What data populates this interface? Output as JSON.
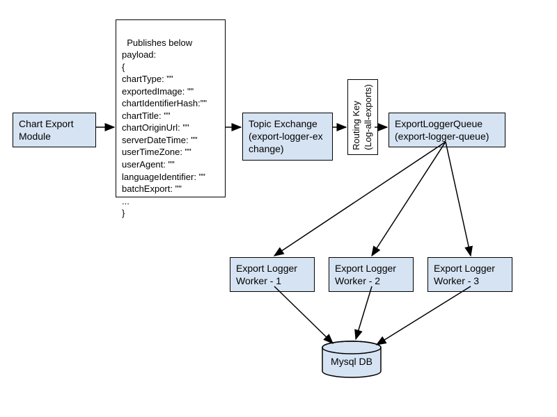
{
  "nodes": {
    "chart_export_module": "Chart Export\nModule",
    "topic_exchange_l1": "Topic Exchange",
    "topic_exchange_l2": "(export-logger-ex\nchange)",
    "routing_key_l1": "Routing Key",
    "routing_key_l2": "(Log-all-exports)",
    "export_logger_queue_l1": "ExportLoggerQueue",
    "export_logger_queue_l2": "(export-logger-queue)",
    "worker1": "Export Logger\nWorker - 1",
    "worker2": "Export Logger\nWorker - 2",
    "worker3": "Export Logger\nWorker - 3",
    "db": "Mysql DB"
  },
  "payload": "Publishes below\npayload:\n{\nchartType: \"\"\nexportedImage: \"\"\nchartIdentifierHash:\"\"\nchartTitle: \"\"\nchartOriginUrl: \"\"\nserverDateTime: \"\"\nuserTimeZone: \"\"\nuserAgent: \"\"\nlanguageIdentifier: \"\"\nbatchExport: \"\"\n...\n}"
}
